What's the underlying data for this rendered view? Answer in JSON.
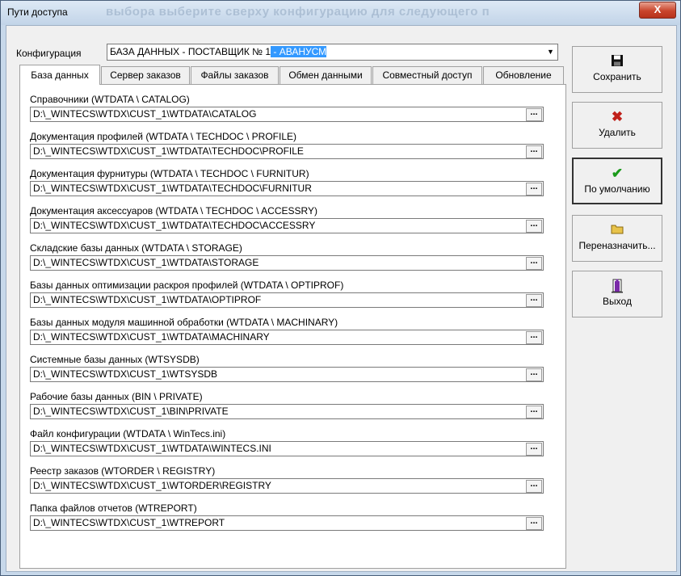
{
  "window": {
    "title": "Пути доступа",
    "title_ghost": "выбора выберите сверху конфигурацию для следующего п",
    "close_glyph": "X"
  },
  "config": {
    "label": "Конфигурация",
    "value_main": "БАЗА ДАННЫХ - ПОСТАВЩИК № 1",
    "value_selected": " - АВАНУСМ"
  },
  "tabs": [
    {
      "label": "База данных",
      "active": true
    },
    {
      "label": "Сервер заказов"
    },
    {
      "label": "Файлы заказов"
    },
    {
      "label": "Обмен данными"
    },
    {
      "label": "Совместный доступ"
    },
    {
      "label": "Обновление"
    }
  ],
  "fields": [
    {
      "label": "Справочники (WTDATA \\ CATALOG)",
      "value": "D:\\_WINTECS\\WTDX\\CUST_1\\WTDATA\\CATALOG"
    },
    {
      "label": "Документация профилей (WTDATA \\ TECHDOC \\ PROFILE)",
      "value": "D:\\_WINTECS\\WTDX\\CUST_1\\WTDATA\\TECHDOC\\PROFILE"
    },
    {
      "label": "Документация фурнитуры (WTDATA \\ TECHDOC \\ FURNITUR)",
      "value": "D:\\_WINTECS\\WTDX\\CUST_1\\WTDATA\\TECHDOC\\FURNITUR"
    },
    {
      "label": "Документация аксессуаров (WTDATA \\ TECHDOC \\ ACCESSRY)",
      "value": "D:\\_WINTECS\\WTDX\\CUST_1\\WTDATA\\TECHDOC\\ACCESSRY"
    },
    {
      "label": "Складские базы данных  (WTDATA \\ STORAGE)",
      "value": "D:\\_WINTECS\\WTDX\\CUST_1\\WTDATA\\STORAGE"
    },
    {
      "label": "Базы данных оптимизации раскроя профилей (WTDATA \\ OPTIPROF)",
      "value": "D:\\_WINTECS\\WTDX\\CUST_1\\WTDATA\\OPTIPROF"
    },
    {
      "label": "Базы данных модуля машинной обработки (WTDATA \\ MACHINARY)",
      "value": "D:\\_WINTECS\\WTDX\\CUST_1\\WTDATA\\MACHINARY"
    },
    {
      "label": "Системные базы данных (WTSYSDB)",
      "value": "D:\\_WINTECS\\WTDX\\CUST_1\\WTSYSDB"
    },
    {
      "label": "Рабочие базы  данных (BIN \\ PRIVATE)",
      "value": "D:\\_WINTECS\\WTDX\\CUST_1\\BIN\\PRIVATE"
    },
    {
      "label": "Файл конфигурации (WTDATA \\ WinTecs.ini)",
      "value": "D:\\_WINTECS\\WTDX\\CUST_1\\WTDATA\\WINTECS.INI"
    },
    {
      "label": "Реестр заказов (WTORDER \\ REGISTRY)",
      "value": "D:\\_WINTECS\\WTDX\\CUST_1\\WTORDER\\REGISTRY"
    },
    {
      "label": "Папка файлов отчетов (WTREPORT)",
      "value": "D:\\_WINTECS\\WTDX\\CUST_1\\WTREPORT"
    }
  ],
  "browse_label": "...",
  "buttons": {
    "save": {
      "label": "Сохранить",
      "icon": "floppy-icon"
    },
    "delete": {
      "label": "Удалить",
      "icon": "red-x-icon"
    },
    "default": {
      "label": "По умолчанию",
      "icon": "green-check-icon"
    },
    "reassign": {
      "label": "Переназначить...",
      "icon": "folder-icon"
    },
    "exit": {
      "label": "Выход",
      "icon": "exit-door-icon"
    }
  },
  "colors": {
    "selection": "#3399ff",
    "delete_icon": "#c0201a",
    "check_icon": "#1a9a1a",
    "folder_icon": "#e8c34a"
  }
}
